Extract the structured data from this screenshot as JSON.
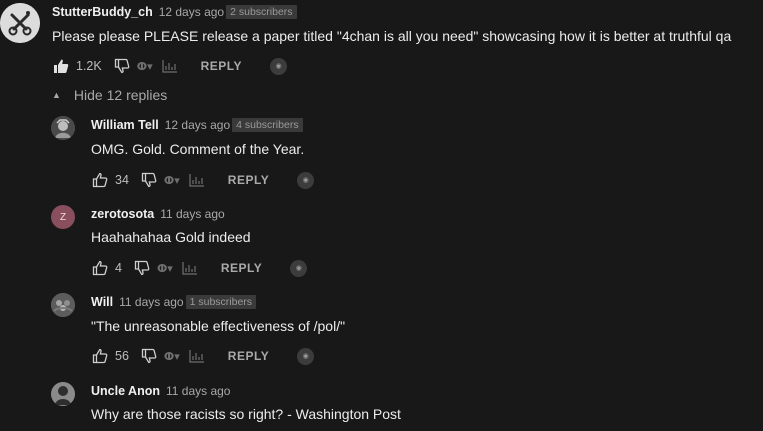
{
  "top_comment": {
    "author": "StutterBuddy_ch",
    "time": "12 days ago",
    "badge": "2 subscribers",
    "text": "Please please PLEASE release a paper titled \"4chan is all you need\" showcasing how it is better at truthful qa",
    "likes": "1.2K",
    "reply_label": "REPLY"
  },
  "hide_replies_label": "Hide 12 replies",
  "replies": [
    {
      "author": "William Tell",
      "time": "12 days ago",
      "badge": "4 subscribers",
      "text": "OMG. Gold. Comment of the Year.",
      "likes": "34",
      "reply_label": "REPLY"
    },
    {
      "author": "zerotosota",
      "time": "11 days ago",
      "badge": "",
      "text": "Haahahahaa Gold indeed",
      "likes": "4",
      "reply_label": "REPLY",
      "avatar_letter": "Z",
      "avatar_color": "#8a4f5e"
    },
    {
      "author": "Will",
      "time": "11 days ago",
      "badge": "1 subscribers",
      "text": "\"The unreasonable effectiveness of /pol/\"",
      "likes": "56",
      "reply_label": "REPLY"
    },
    {
      "author": "Uncle Anon",
      "time": "11 days ago",
      "badge": "",
      "text": "Why are those racists so right? - Washington Post"
    }
  ],
  "colors": {
    "background": "#181818",
    "text": "#ececec",
    "muted": "#a8a8a8",
    "badge_bg": "#3a3a3a"
  },
  "icons": [
    "thumbs-up-icon",
    "thumbs-down-icon",
    "extension-glyph-icon",
    "chart-icon",
    "extension-badge-icon",
    "caret-up-icon"
  ]
}
